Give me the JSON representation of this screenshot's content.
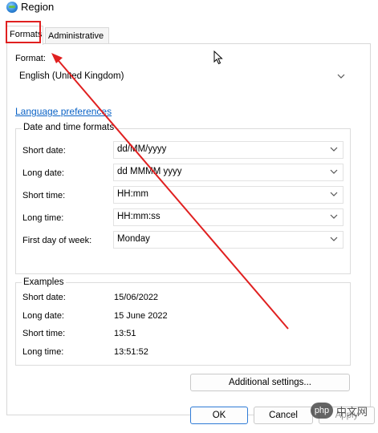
{
  "window": {
    "title": "Region"
  },
  "tabs": [
    {
      "label": "Formats"
    },
    {
      "label": "Administrative"
    }
  ],
  "format": {
    "label": "Format:",
    "value": "English (United Kingdom)"
  },
  "language_link": "Language preferences",
  "date_time": {
    "title": "Date and time formats",
    "rows": [
      {
        "label": "Short date:",
        "value": "dd/MM/yyyy"
      },
      {
        "label": "Long date:",
        "value": "dd MMMM yyyy"
      },
      {
        "label": "Short time:",
        "value": "HH:mm"
      },
      {
        "label": "Long time:",
        "value": "HH:mm:ss"
      },
      {
        "label": "First day of week:",
        "value": "Monday"
      }
    ]
  },
  "examples": {
    "title": "Examples",
    "rows": [
      {
        "label": "Short date:",
        "value": "15/06/2022"
      },
      {
        "label": "Long date:",
        "value": "15 June 2022"
      },
      {
        "label": "Short time:",
        "value": "13:51"
      },
      {
        "label": "Long time:",
        "value": "13:51:52"
      }
    ]
  },
  "buttons": {
    "additional": "Additional settings...",
    "ok": "OK",
    "cancel": "Cancel",
    "apply": "Apply"
  },
  "watermark": {
    "text": "中文网",
    "logo": "php"
  },
  "colors": {
    "annotation": "#e02020",
    "link": "#0b63c6",
    "ok_border": "#2f7bd6"
  }
}
